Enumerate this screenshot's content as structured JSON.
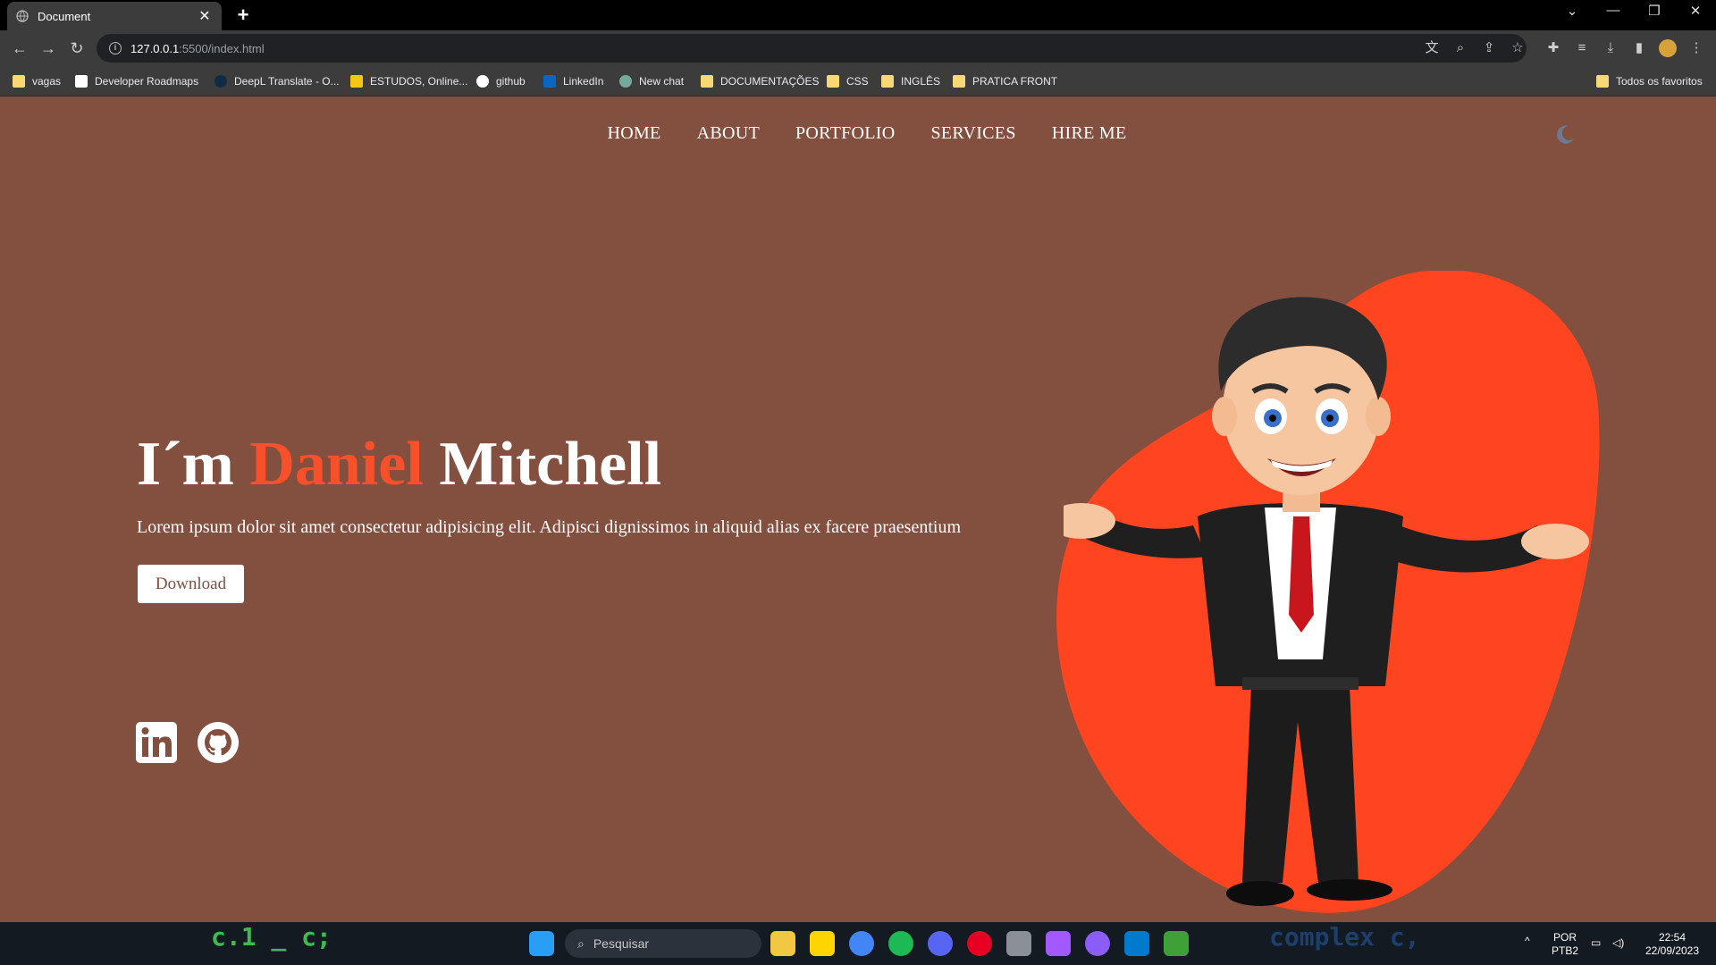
{
  "browser": {
    "tab_title": "Document",
    "url_host": "127.0.0.1",
    "url_path": ":5500/index.html",
    "bookmarks": [
      "vagas",
      "Developer Roadmaps",
      "DeepL Translate - O...",
      "ESTUDOS, Online...",
      "github",
      "LinkedIn",
      "New chat",
      "DOCUMENTAÇÕES",
      "CSS",
      "INGLÊS",
      "PRATICA FRONT"
    ],
    "all_bookmarks_label": "Todos os favoritos"
  },
  "page": {
    "nav": [
      "HOME",
      "ABOUT",
      "PORTFOLIO",
      "SERVICES",
      "HIRE ME"
    ],
    "hero_prefix": "I´m ",
    "hero_accent": "Daniel",
    "hero_suffix": " Mitchell",
    "description": "Lorem ipsum dolor sit amet consectetur adipisicing elit. Adipisci dignissimos in aliquid alias ex facere praesentium",
    "download_label": "Download",
    "colors": {
      "background": "#834f3f",
      "accent": "#f7502b",
      "blob": "#fe4520"
    }
  },
  "taskbar": {
    "search_placeholder": "Pesquisar",
    "language": "POR",
    "layout": "PTB2",
    "time": "22:54",
    "date": "22/09/2023"
  }
}
